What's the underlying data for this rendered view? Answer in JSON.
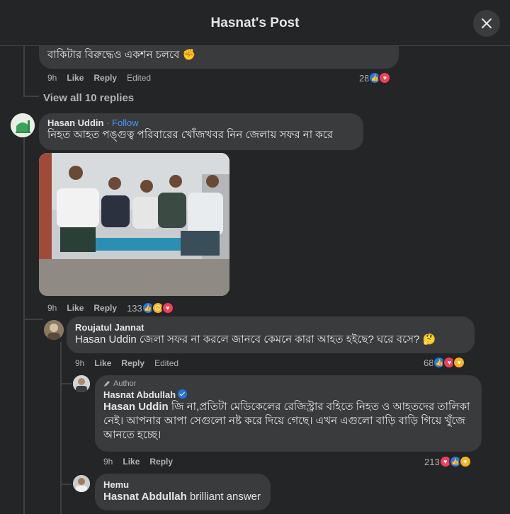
{
  "header": {
    "title": "Hasnat's Post"
  },
  "top_comment": {
    "text": "বাকিটার বিরুদ্ধেও একশন চলবে ✊",
    "time": "9h",
    "like": "Like",
    "reply": "Reply",
    "edited": "Edited",
    "reaction_count": "28"
  },
  "view_replies": "View all 10 replies",
  "hasan_comment": {
    "name": "Hasan Uddin",
    "follow": "· Follow",
    "text": "নিহত আহত পঙ্গুত্ব পরিবারের খোঁজখবর নিন জেলায় সফর না করে",
    "time": "9h",
    "like": "Like",
    "reply": "Reply",
    "reaction_count": "133"
  },
  "roujatul_reply": {
    "name": "Roujatul Jannat",
    "text": "Hasan Uddin জেলা সফর না করলে জানবে কেমনে কারা আহত হইছে? ঘরে বসে? 🤔",
    "time": "9h",
    "like": "Like",
    "reply": "Reply",
    "edited": "Edited",
    "reaction_count": "68"
  },
  "hasnat_reply": {
    "author_tag": "Author",
    "name": "Hasnat Abdullah",
    "mention": "Hasan Uddin",
    "text": " জি না,প্রতিটা মেডিকেলের রেজিস্ট্রার বহিতে নিহত ও আহতদের তালিকা নেই। আপনার আপা সেগুলো নষ্ট করে দিয়ে গেছে। এখন এগুলো বাড়ি বাড়ি গিয়ে খুঁজে আনতে হচ্ছে।",
    "time": "9h",
    "like": "Like",
    "reply": "Reply",
    "reaction_count": "213"
  },
  "hemu_reply": {
    "name": "Hemu",
    "mention": "Hasnat Abdullah",
    "text": " brilliant answer"
  },
  "colors": {
    "like": "#2078f4",
    "love": "#f33e58",
    "sad": "#f7b125",
    "link": "#4599ff"
  }
}
